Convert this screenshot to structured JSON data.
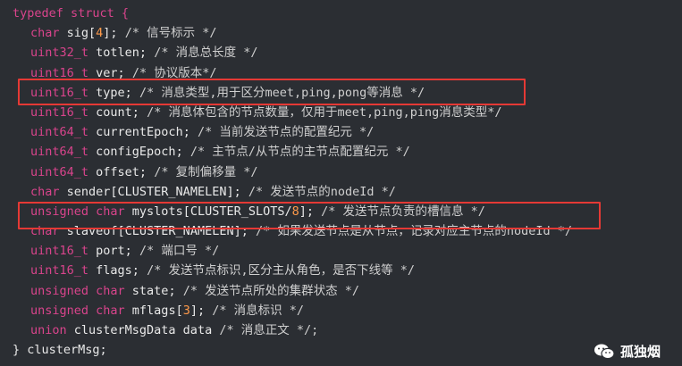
{
  "code": {
    "header": "typedef struct {",
    "footer": "} clusterMsg;",
    "fields": [
      {
        "type": "char",
        "name": " sig[",
        "num": "4",
        "rest": "]; ",
        "comment": "/* 信号标示 */"
      },
      {
        "type": "uint32_t",
        "name": " totlen; ",
        "num": "",
        "rest": "",
        "comment": "/* 消息总长度 */"
      },
      {
        "type": "uint16_t",
        "name": " ver; ",
        "num": "",
        "rest": "",
        "comment": "/* 协议版本*/"
      },
      {
        "type": "uint16_t",
        "name": " type; ",
        "num": "",
        "rest": "",
        "comment": "/* 消息类型,用于区分meet,ping,pong等消息 */"
      },
      {
        "type": "uint16_t",
        "name": " count; ",
        "num": "",
        "rest": "",
        "comment": "/* 消息体包含的节点数量，仅用于meet,ping,ping消息类型*/"
      },
      {
        "type": "uint64_t",
        "name": " currentEpoch; ",
        "num": "",
        "rest": "",
        "comment": "/* 当前发送节点的配置纪元 */"
      },
      {
        "type": "uint64_t",
        "name": " configEpoch; ",
        "num": "",
        "rest": "",
        "comment": "/* 主节点/从节点的主节点配置纪元 */"
      },
      {
        "type": "uint64_t",
        "name": " offset; ",
        "num": "",
        "rest": "",
        "comment": "/* 复制偏移量 */"
      },
      {
        "type": "char",
        "name": " sender[CLUSTER_NAMELEN]; ",
        "num": "",
        "rest": "",
        "comment": "/* 发送节点的nodeId */"
      },
      {
        "type": "unsigned char",
        "name": " myslots[CLUSTER_SLOTS/",
        "num": "8",
        "rest": "]; ",
        "comment": "/* 发送节点负责的槽信息 */"
      },
      {
        "type": "char",
        "name": " slaveof[CLUSTER_NAMELEN]; ",
        "num": "",
        "rest": "",
        "comment": "/* 如果发送节点是从节点，记录对应主节点的nodeId */"
      },
      {
        "type": "uint16_t",
        "name": " port; ",
        "num": "",
        "rest": "",
        "comment": "/* 端口号 */"
      },
      {
        "type": "uint16_t",
        "name": " flags; ",
        "num": "",
        "rest": "",
        "comment": "/* 发送节点标识,区分主从角色，是否下线等 */"
      },
      {
        "type": "unsigned char",
        "name": " state; ",
        "num": "",
        "rest": "",
        "comment": "/* 发送节点所处的集群状态 */"
      },
      {
        "type": "unsigned char",
        "name": " mflags[",
        "num": "3",
        "rest": "]; ",
        "comment": "/* 消息标识 */"
      },
      {
        "type": "union",
        "name": " clusterMsgData data ",
        "num": "",
        "rest": "",
        "comment": "/* 消息正文 */;"
      }
    ]
  },
  "watermark": {
    "text": "孤独烟",
    "icon": "wechat-icon"
  },
  "colors": {
    "keyword": "#d9448c",
    "number": "#ff9a4a",
    "highlight": "#e53935",
    "background": "#2b2e33"
  }
}
